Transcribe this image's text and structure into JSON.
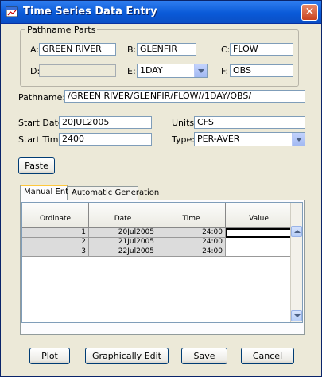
{
  "window": {
    "title": "Time Series Data Entry",
    "close_glyph": "✕"
  },
  "pathname_parts": {
    "legend": "Pathname Parts",
    "a": {
      "label": "A:",
      "value": "GREEN RIVER"
    },
    "b": {
      "label": "B:",
      "value": "GLENFIR"
    },
    "c": {
      "label": "C:",
      "value": "FLOW"
    },
    "d": {
      "label": "D:",
      "value": ""
    },
    "e": {
      "label": "E:",
      "value": "1DAY"
    },
    "f": {
      "label": "F:",
      "value": "OBS"
    }
  },
  "pathname": {
    "label": "Pathname:",
    "value": "/GREEN RIVER/GLENFIR/FLOW//1DAY/OBS/"
  },
  "start_date": {
    "label": "Start Date:",
    "value": "20JUL2005"
  },
  "units": {
    "label": "Units:",
    "value": "CFS"
  },
  "start_time": {
    "label": "Start Time:",
    "value": "2400"
  },
  "type": {
    "label": "Type:",
    "value": "PER-AVER"
  },
  "paste_label": "Paste",
  "tabs": [
    {
      "label": "Manual Entry",
      "active": true
    },
    {
      "label": "Automatic Generation",
      "active": false
    }
  ],
  "table": {
    "headers": [
      "Ordinate",
      "Date",
      "Time",
      "Value"
    ],
    "rows": [
      {
        "ordinate": "1",
        "date": "20Jul2005",
        "time": "24:00",
        "value": ""
      },
      {
        "ordinate": "2",
        "date": "21Jul2005",
        "time": "24:00",
        "value": ""
      },
      {
        "ordinate": "3",
        "date": "22Jul2005",
        "time": "24:00",
        "value": ""
      }
    ]
  },
  "footer": {
    "plot_label": "Plot",
    "graph_edit_label": "Graphically Edit",
    "save_label": "Save",
    "cancel_label": "Cancel"
  },
  "icons": {
    "app": "application-icon",
    "combo_arrow": "chevron-down-icon"
  }
}
